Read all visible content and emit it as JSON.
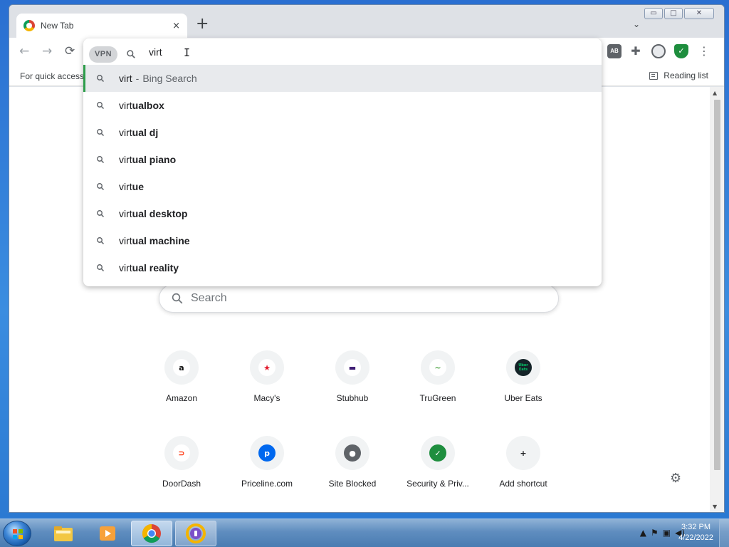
{
  "window_controls": {
    "minimize": "▭",
    "restore": "□",
    "close": "✕"
  },
  "tab": {
    "title": "New Tab",
    "close_label": "×"
  },
  "new_tab_label": "+",
  "tab_search_label": "⌄",
  "toolbar": {
    "back": "←",
    "forward": "→",
    "reload": "⟳"
  },
  "omnibox": {
    "vpn_badge": "VPN",
    "query": "virt"
  },
  "suggestions": [
    {
      "typed": "virt",
      "completion": "",
      "separator": "-",
      "provider": "Bing Search",
      "selected": true
    },
    {
      "typed": "virt",
      "completion": "ualbox"
    },
    {
      "typed": "virt",
      "completion": "ual dj"
    },
    {
      "typed": "virt",
      "completion": "ual piano"
    },
    {
      "typed": "virt",
      "completion": "ue"
    },
    {
      "typed": "virt",
      "completion": "ual desktop"
    },
    {
      "typed": "virt",
      "completion": "ual machine"
    },
    {
      "typed": "virt",
      "completion": "ual reality"
    }
  ],
  "bookmarks_bar": {
    "text": "For quick access,",
    "reading_list": "Reading list"
  },
  "ntp": {
    "search_placeholder": "Search",
    "shortcuts": [
      {
        "label": "Amazon",
        "icon": "amazon-icon",
        "glyph": "a",
        "color": "#ffffff",
        "text_color": "#111111"
      },
      {
        "label": "Macy's",
        "icon": "macys-icon",
        "glyph": "★",
        "color": "#ffffff",
        "text_color": "#e21a2c"
      },
      {
        "label": "Stubhub",
        "icon": "stubhub-icon",
        "glyph": "▬",
        "color": "#ffffff",
        "text_color": "#3f1d74"
      },
      {
        "label": "TruGreen",
        "icon": "trugreen-icon",
        "glyph": "~",
        "color": "#ffffff",
        "text_color": "#48a23f"
      },
      {
        "label": "Uber Eats",
        "icon": "uber-eats-icon",
        "glyph": "Uber Eats",
        "color": "#142328",
        "text_color": "#06c167"
      },
      {
        "label": "DoorDash",
        "icon": "doordash-icon",
        "glyph": "⊃",
        "color": "#ffffff",
        "text_color": "#ff3008"
      },
      {
        "label": "Priceline.com",
        "icon": "priceline-icon",
        "glyph": "p",
        "color": "#0068ef",
        "text_color": "#ffffff"
      },
      {
        "label": "Site Blocked",
        "icon": "globe-icon",
        "glyph": "●",
        "color": "#5f6368",
        "text_color": "#ffffff"
      },
      {
        "label": "Security & Priv...",
        "icon": "shield-icon",
        "glyph": "✓",
        "color": "#1e8e3e",
        "text_color": "#ffffff"
      },
      {
        "label": "Add shortcut",
        "icon": "plus-icon",
        "glyph": "+",
        "color": "#f1f3f4",
        "text_color": "#202124"
      }
    ]
  },
  "taskbar": {
    "items": [
      {
        "name": "file-explorer",
        "icon": "folder-icon"
      },
      {
        "name": "media-player",
        "icon": "media-player-icon"
      },
      {
        "name": "chrome",
        "icon": "chrome-icon",
        "state": "active"
      },
      {
        "name": "vpn-app",
        "icon": "vpn-app-icon",
        "state": "open"
      }
    ],
    "clock": {
      "time": "3:32 PM",
      "date": "4/22/2022"
    }
  },
  "colors": {
    "accent_green": "#2d9d4a",
    "chrome_tab_strip": "#dee1e6"
  }
}
